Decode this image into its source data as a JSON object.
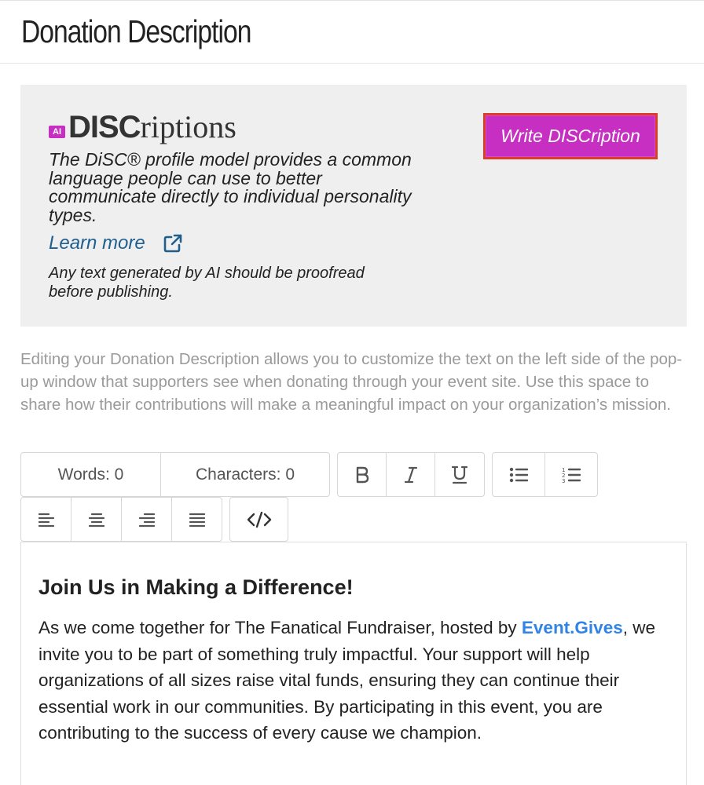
{
  "page": {
    "title": "Donation Description"
  },
  "ai_panel": {
    "badge": "AI",
    "brand_bold": "DISC",
    "brand_light": "riptions",
    "description": "The DiSC® profile model provides a common language people can use to better communicate directly to individual personality types.",
    "learn_more": "Learn more",
    "disclaimer": "Any text generated by AI should be proofread before publishing.",
    "button_label": "Write DISCription",
    "colors": {
      "button": "#c72fc2",
      "button_border": "#e03a2a",
      "link": "#1f5f8f",
      "panel_bg": "#efefef"
    }
  },
  "help_text": "Editing your Donation Description allows you to customize the text on the left side of the pop-up window that supporters see when donating through your event site. Use this space to share how their contributions will make a meaningful impact on your organization’s mission.",
  "toolbar": {
    "words": "Words: 0",
    "characters": "Characters: 0",
    "icons": [
      "bold-icon",
      "italic-icon",
      "underline-icon",
      "bullet-list-icon",
      "numbered-list-icon",
      "align-left-icon",
      "align-center-icon",
      "align-right-icon",
      "align-justify-icon",
      "code-view-icon"
    ]
  },
  "editor": {
    "heading": "Join Us in Making a Difference!",
    "body_before_link": "As we come together for The Fanatical Fundraiser, hosted by ",
    "link_text": "Event.Gives",
    "body_after_link": ", we invite you to be part of something truly impactful. Your support will help organizations of all sizes raise vital funds, ensuring they can continue their essential work in our communities. By participating in this event, you are contributing to the success of every cause we champion.",
    "link_color": "#2f84e6"
  }
}
